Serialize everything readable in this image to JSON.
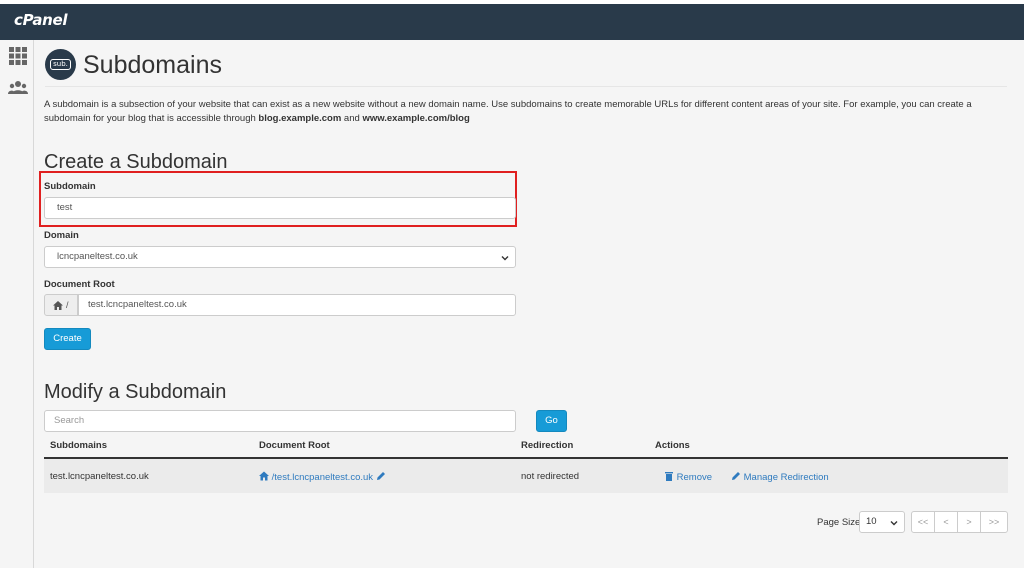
{
  "header": {
    "logo": "cPanel"
  },
  "page": {
    "icon_label": "sub.",
    "title": "Subdomains",
    "description_1": "A subdomain is a subsection of your website that can exist as a new website without a new domain name. Use subdomains to create memorable URLs for different content areas of your site. For example, you can create a subdomain for your blog that is accessible through ",
    "description_ex1": "blog.example.com",
    "description_and": " and ",
    "description_ex2": "www.example.com/blog"
  },
  "create": {
    "heading": "Create a Subdomain",
    "subdomain_label": "Subdomain",
    "subdomain_value": "test",
    "domain_label": "Domain",
    "domain_value": "lcncpaneltest.co.uk",
    "docroot_label": "Document Root",
    "docroot_prefix": "/",
    "docroot_value": "test.lcncpaneltest.co.uk",
    "create_button": "Create"
  },
  "modify": {
    "heading": "Modify a Subdomain",
    "search_placeholder": "Search",
    "go_button": "Go",
    "columns": [
      "Subdomains",
      "Document Root",
      "Redirection",
      "Actions"
    ],
    "rows": [
      {
        "subdomain": "test.lcncpaneltest.co.uk",
        "docroot": "/test.lcncpaneltest.co.uk",
        "redirection": "not redirected",
        "remove": "Remove",
        "manage": "Manage Redirection"
      }
    ]
  },
  "pagination": {
    "page_size_label": "Page Size",
    "page_size": "10",
    "first": "<<",
    "prev": "<",
    "next": ">",
    "last": ">>"
  },
  "colors": {
    "topbar": "#293a4a",
    "primary": "#179bd7",
    "highlight": "#e02020",
    "link": "#2f7bbf"
  }
}
